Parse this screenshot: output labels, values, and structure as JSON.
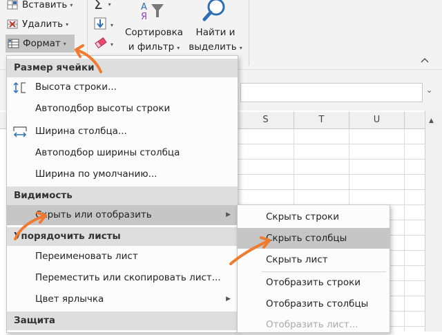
{
  "ribbon": {
    "insert_label": "Вставить",
    "delete_label": "Удалить",
    "format_label": "Формат",
    "sort_filter_line1": "Сортировка",
    "sort_filter_line2": "и фильтр",
    "find_select_line1": "Найти и",
    "find_select_line2": "выделить",
    "sigma_symbol": "Σ"
  },
  "sheet": {
    "column_headers": [
      "S",
      "T",
      "U"
    ]
  },
  "format_menu": {
    "sections": {
      "cell_size": "Размер ячейки",
      "visibility": "Видимость",
      "organize_sheets": "Упорядочить листы",
      "protection": "Защита"
    },
    "items": {
      "row_height": "Высота строки...",
      "autofit_row_height": "Автоподбор высоты строки",
      "column_width": "Ширина столбца...",
      "autofit_column_width": "Автоподбор ширины столбца",
      "default_width": "Ширина по умолчанию...",
      "hide_unhide": "Скрыть или отобразить",
      "rename_sheet": "Переименовать лист",
      "move_copy_sheet": "Переместить или скопировать лист...",
      "tab_color": "Цвет ярлычка"
    }
  },
  "hide_submenu": {
    "items": {
      "hide_rows": "Скрыть строки",
      "hide_columns": "Скрыть столбцы",
      "hide_sheet": "Скрыть лист",
      "unhide_rows": "Отобразить строки",
      "unhide_columns": "Отобразить столбцы",
      "unhide_sheet": "Отобразить лист..."
    }
  },
  "colors": {
    "annotation_arrow": "#f07a2e",
    "menu_highlight": "#c6c6c6",
    "section_bg": "#dedede",
    "ribbon_bg": "#f3f3f3",
    "icon_blue": "#2f6db5"
  }
}
